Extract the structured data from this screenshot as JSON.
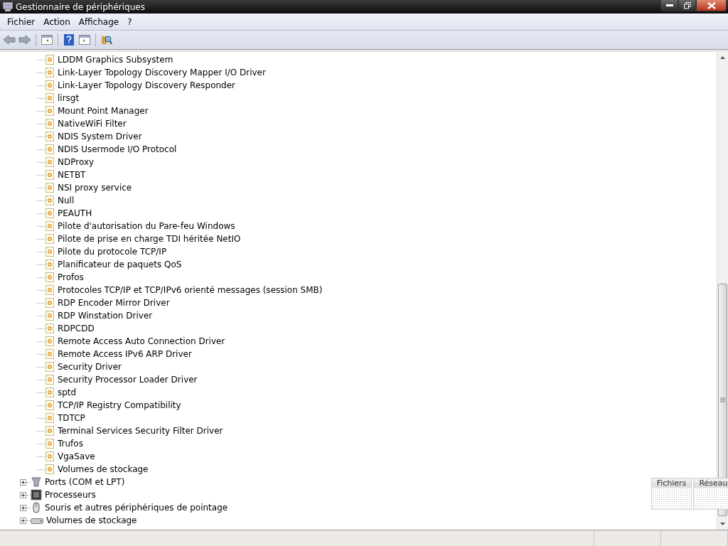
{
  "window": {
    "title": "Gestionnaire de périphériques"
  },
  "menu": [
    "Fichier",
    "Action",
    "Affichage",
    "?"
  ],
  "toolbar": [
    {
      "kind": "back"
    },
    {
      "kind": "forward"
    },
    {
      "kind": "sep"
    },
    {
      "kind": "console"
    },
    {
      "kind": "sep"
    },
    {
      "kind": "help"
    },
    {
      "kind": "panel"
    },
    {
      "kind": "sep"
    },
    {
      "kind": "scan"
    }
  ],
  "tree": {
    "items": [
      {
        "label": "LDDM Graphics Subsystem"
      },
      {
        "label": "Link-Layer Topology Discovery Mapper I/O Driver"
      },
      {
        "label": "Link-Layer Topology Discovery Responder"
      },
      {
        "label": "lirsgt"
      },
      {
        "label": "Mount Point Manager"
      },
      {
        "label": "NativeWiFi Filter"
      },
      {
        "label": "NDIS System Driver"
      },
      {
        "label": "NDIS Usermode I/O Protocol"
      },
      {
        "label": "NDProxy"
      },
      {
        "label": "NETBT"
      },
      {
        "label": "NSI proxy service"
      },
      {
        "label": "Null"
      },
      {
        "label": "PEAUTH"
      },
      {
        "label": "Pilote d'autorisation du Pare-feu Windows"
      },
      {
        "label": "Pilote de prise en charge TDI héritée NetIO"
      },
      {
        "label": "Pilote du protocole TCP/IP"
      },
      {
        "label": "Planificateur de paquets QoS"
      },
      {
        "label": "Profos"
      },
      {
        "label": "Protocoles TCP/IP et TCP/IPv6 orienté messages (session SMB)"
      },
      {
        "label": "RDP Encoder Mirror Driver"
      },
      {
        "label": "RDP Winstation Driver"
      },
      {
        "label": "RDPCDD"
      },
      {
        "label": "Remote Access Auto Connection Driver"
      },
      {
        "label": "Remote Access IPv6 ARP Driver"
      },
      {
        "label": "Security Driver"
      },
      {
        "label": "Security Processor Loader Driver"
      },
      {
        "label": "sptd"
      },
      {
        "label": "TCP/IP Registry Compatibility"
      },
      {
        "label": "TDTCP"
      },
      {
        "label": "Terminal Services Security Filter Driver"
      },
      {
        "label": "Trufos"
      },
      {
        "label": "VgaSave"
      },
      {
        "label": "Volumes de stockage"
      }
    ],
    "categories": [
      {
        "label": "Ports (COM et LPT)",
        "kind": "port",
        "expanded": false
      },
      {
        "label": "Processeurs",
        "kind": "cpu",
        "expanded": false
      },
      {
        "label": "Souris et autres périphériques de pointage",
        "kind": "mouse",
        "expanded": false
      },
      {
        "label": "Volumes de stockage",
        "kind": "drive",
        "expanded": false
      }
    ]
  },
  "gadget": {
    "tabs": [
      "Fichiers",
      "Réseau"
    ]
  }
}
